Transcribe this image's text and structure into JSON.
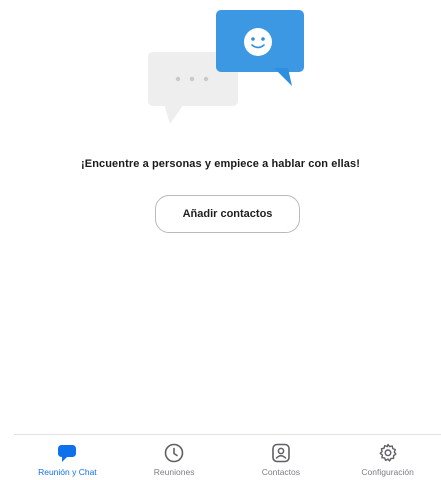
{
  "colors": {
    "accent": "#0e71eb",
    "illustration_bubble_blue": "#2e8fe0",
    "illustration_bubble_gray": "#eeeeef",
    "tab_inactive": "#7d7d85",
    "button_border": "#b9b9bf"
  },
  "empty_state": {
    "message": "¡Encuentre a personas y empiece a hablar con ellas!",
    "add_contacts_label": "Añadir contactos",
    "illustration_icons": [
      "chat-bubble-smiley-icon",
      "chat-bubble-typing-icon"
    ]
  },
  "tabbar": {
    "active_tab": "chat",
    "tabs": [
      {
        "id": "chat",
        "label": "Reunión y Chat",
        "icon": "chat-bubble-icon"
      },
      {
        "id": "meetings",
        "label": "Reuniones",
        "icon": "clock-icon"
      },
      {
        "id": "contacts",
        "label": "Contactos",
        "icon": "contact-card-icon"
      },
      {
        "id": "settings",
        "label": "Configuración",
        "icon": "gear-icon"
      }
    ]
  }
}
